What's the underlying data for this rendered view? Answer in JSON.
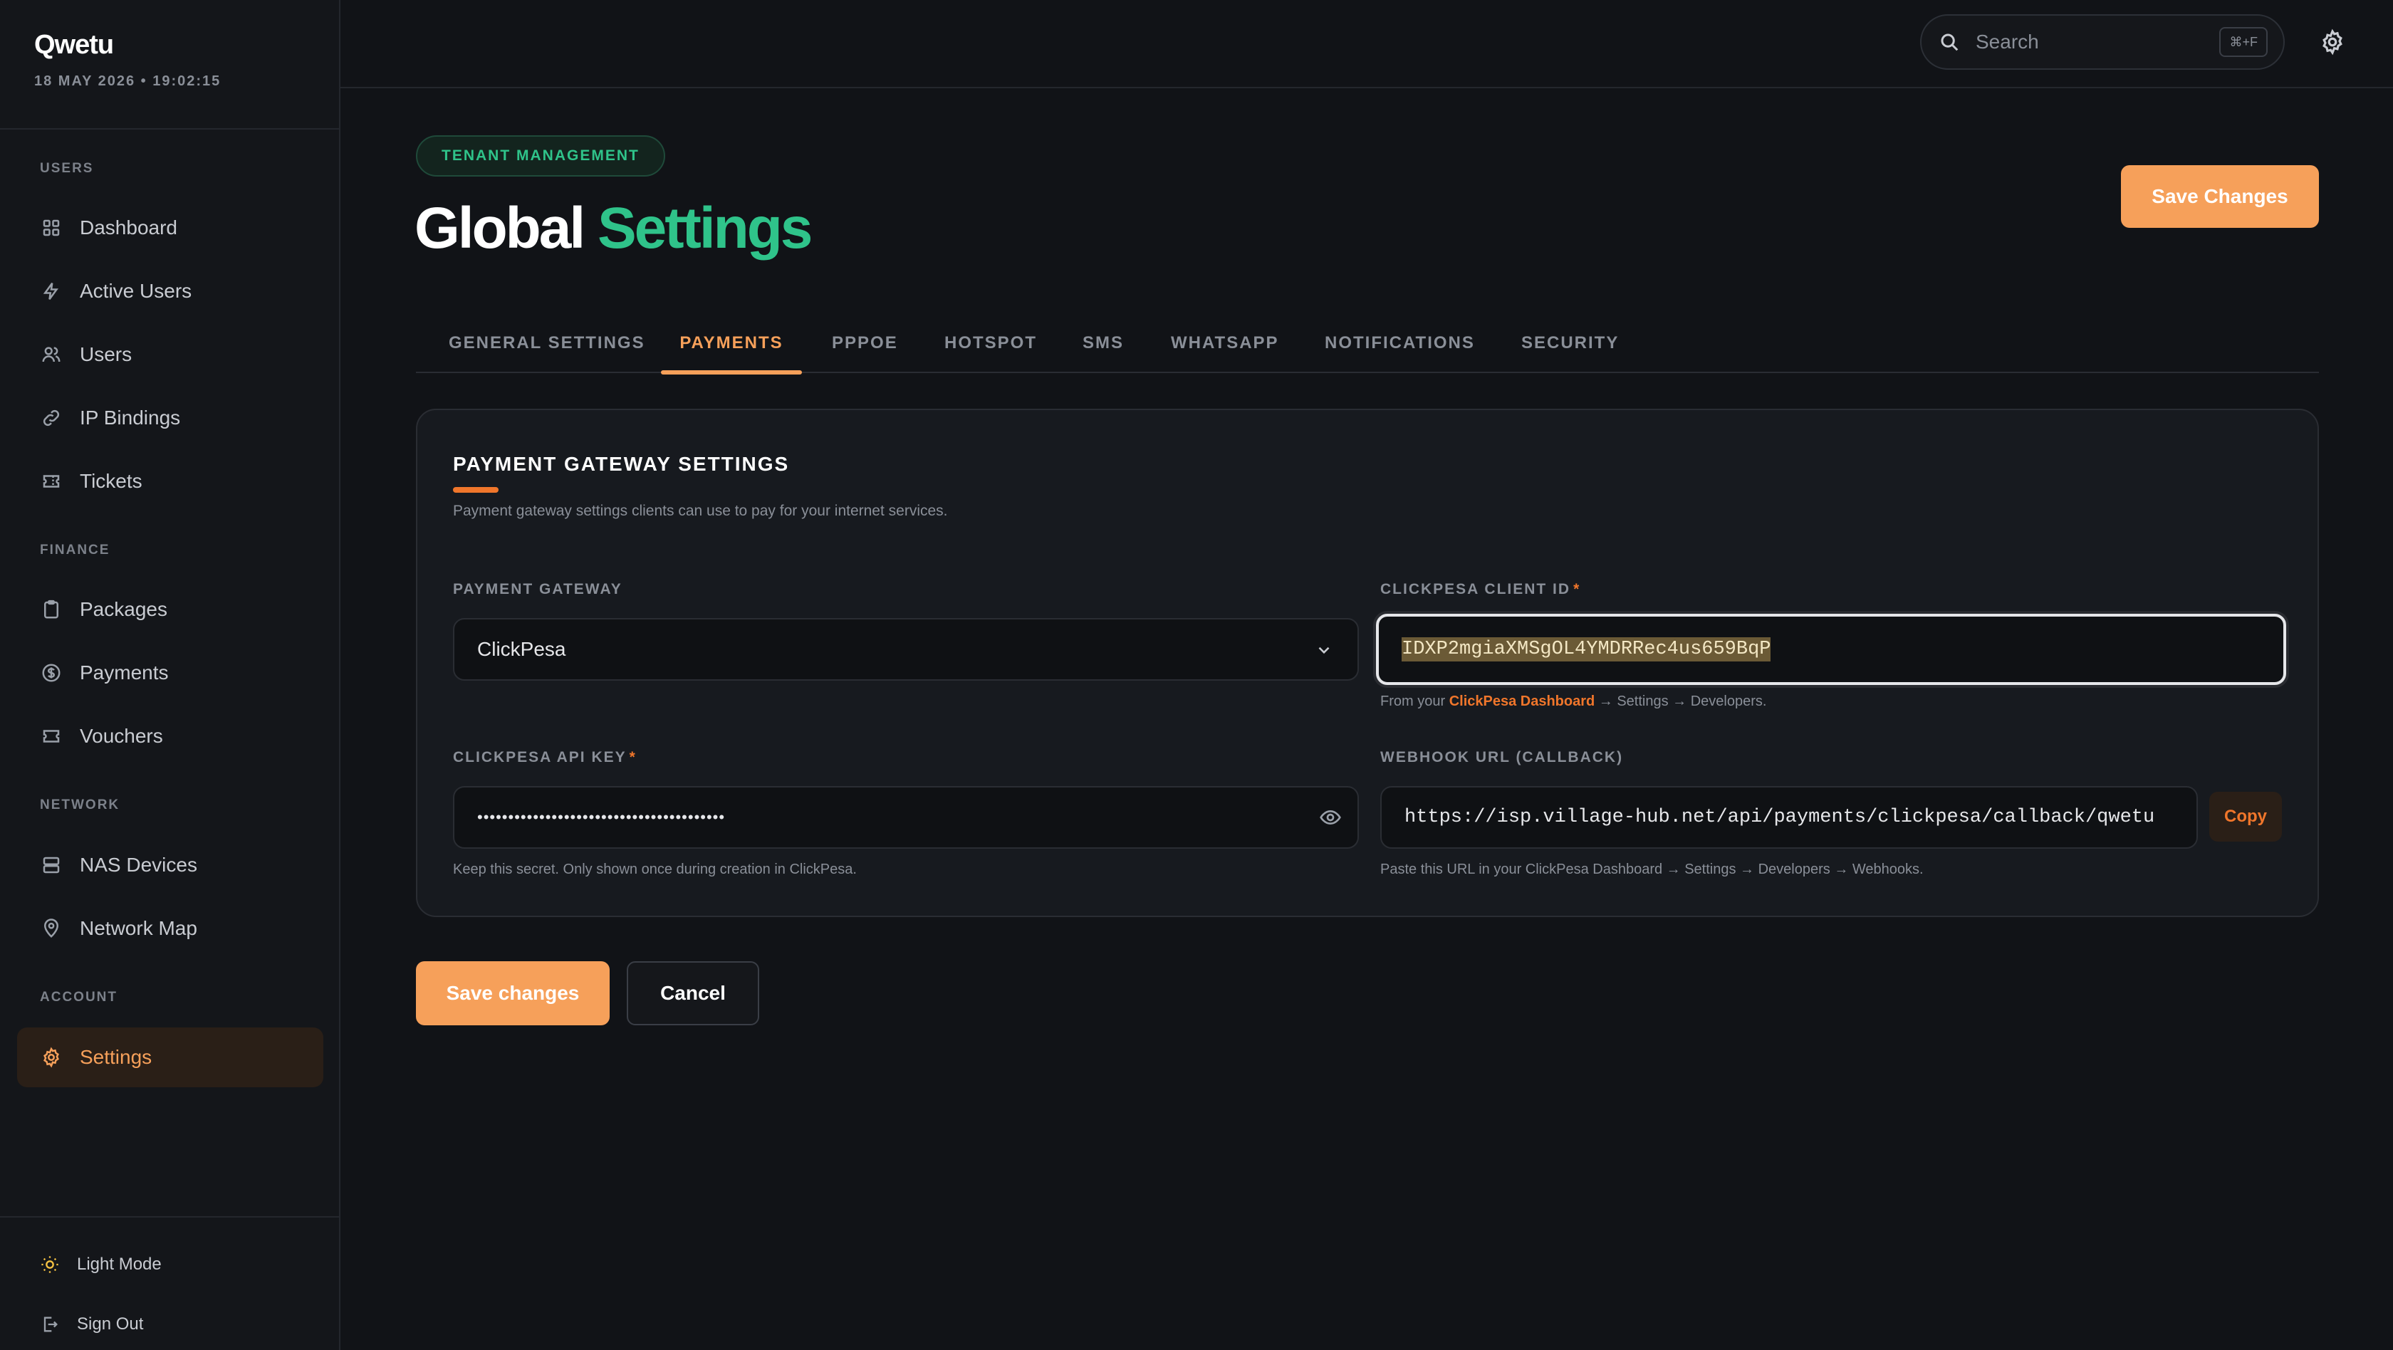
{
  "brand": {
    "name": "Qwetu",
    "datetime": "18 MAY 2026 • 19:02:15"
  },
  "sidebar": {
    "sections": [
      {
        "label": "USERS"
      },
      {
        "label": "FINANCE"
      },
      {
        "label": "NETWORK"
      },
      {
        "label": "ACCOUNT"
      }
    ],
    "items": [
      {
        "label": "Dashboard",
        "icon": "grid-icon"
      },
      {
        "label": "Active Users",
        "icon": "bolt-icon"
      },
      {
        "label": "Users",
        "icon": "users-icon"
      },
      {
        "label": "IP Bindings",
        "icon": "link-icon"
      },
      {
        "label": "Tickets",
        "icon": "ticket-icon"
      },
      {
        "label": "Packages",
        "icon": "clipboard-icon"
      },
      {
        "label": "Payments",
        "icon": "dollar-circle-icon"
      },
      {
        "label": "Vouchers",
        "icon": "voucher-icon"
      },
      {
        "label": "NAS Devices",
        "icon": "server-icon"
      },
      {
        "label": "Network Map",
        "icon": "map-pin-icon"
      },
      {
        "label": "Settings",
        "icon": "gear-icon",
        "active": true
      }
    ],
    "bottom": {
      "light_mode": "Light Mode",
      "sign_out": "Sign Out"
    }
  },
  "topbar": {
    "search_placeholder": "Search",
    "shortcut": "⌘+F"
  },
  "header": {
    "badge": "TENANT MANAGEMENT",
    "title_part1": "Global",
    "title_part2": "Settings",
    "save_label": "Save Changes"
  },
  "tabs": [
    {
      "label": "GENERAL SETTINGS"
    },
    {
      "label": "PAYMENTS",
      "active": true
    },
    {
      "label": "PPPOE"
    },
    {
      "label": "HOTSPOT"
    },
    {
      "label": "SMS"
    },
    {
      "label": "WHATSAPP"
    },
    {
      "label": "NOTIFICATIONS"
    },
    {
      "label": "SECURITY"
    }
  ],
  "card": {
    "title": "PAYMENT GATEWAY SETTINGS",
    "description": "Payment gateway settings clients can use to pay for your internet services.",
    "gateway": {
      "label": "PAYMENT GATEWAY",
      "value": "ClickPesa"
    },
    "client_id": {
      "label": "CLICKPESA CLIENT ID",
      "required_mark": "*",
      "value": "IDXP2mgiaXMSgOL4YMDRRec4us659BqP",
      "hint_prefix": "From your",
      "hint_link": "ClickPesa Dashboard",
      "hint_suffix": "→ Settings → Developers."
    },
    "api_key": {
      "label": "CLICKPESA API KEY",
      "required_mark": "*",
      "value": "••••••••••••••••••••••••••••••••••••••••",
      "hint": "Keep this secret. Only shown once during creation in ClickPesa."
    },
    "webhook": {
      "label": "WEBHOOK URL (CALLBACK)",
      "value": "https://isp.village-hub.net/api/payments/clickpesa/callback/qwetu",
      "copy_label": "Copy",
      "hint": "Paste this URL in your ClickPesa Dashboard → Settings → Developers → Webhooks."
    }
  },
  "footer": {
    "save_label": "Save changes",
    "cancel_label": "Cancel"
  },
  "colors": {
    "accent": "#f6a05a",
    "brand_green": "#2fc38a",
    "background": "#111317"
  }
}
